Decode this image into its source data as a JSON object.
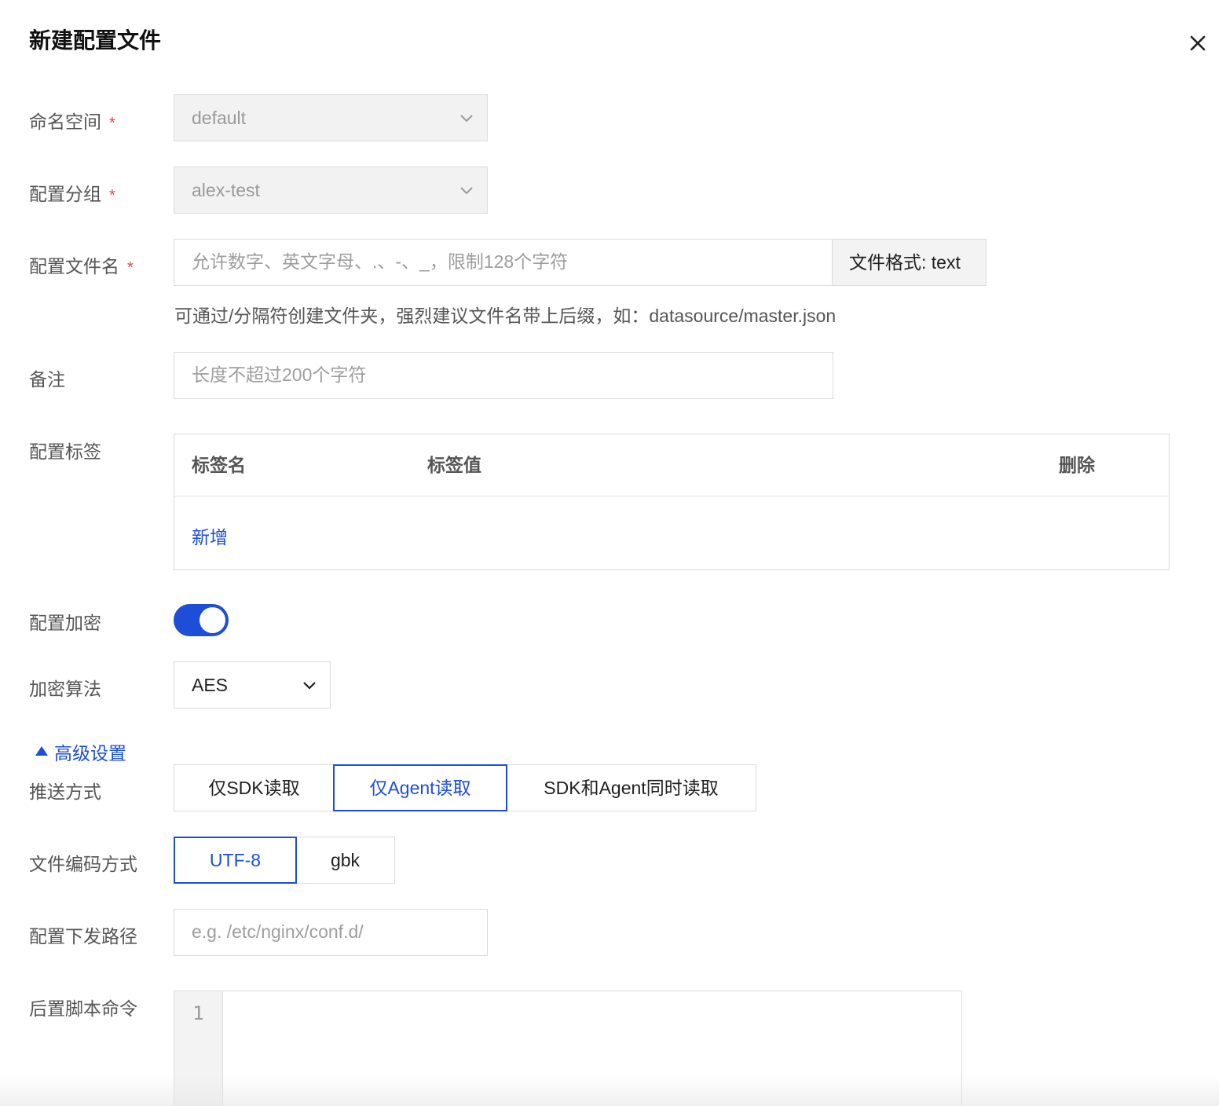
{
  "dialog": {
    "title": "新建配置文件",
    "close_icon": "close-icon"
  },
  "namespace": {
    "label": "命名空间",
    "required": "*",
    "value": "default"
  },
  "group": {
    "label": "配置分组",
    "required": "*",
    "value": "alex-test"
  },
  "filename": {
    "label": "配置文件名",
    "required": "*",
    "placeholder": "允许数字、英文字母、.、-、_，限制128个字符",
    "format_addon": "文件格式: text",
    "hint": "可通过/分隔符创建文件夹，强烈建议文件名带上后缀，如：datasource/master.json"
  },
  "remark": {
    "label": "备注",
    "placeholder": "长度不超过200个字符"
  },
  "tags": {
    "label": "配置标签",
    "col_name": "标签名",
    "col_value": "标签值",
    "col_delete": "删除",
    "add_link": "新增"
  },
  "encryption": {
    "label": "配置加密",
    "enabled": true
  },
  "algorithm": {
    "label": "加密算法",
    "value": "AES"
  },
  "advanced": {
    "toggle_label": "高级设置",
    "expanded": true
  },
  "push_mode": {
    "label": "推送方式",
    "options": [
      "仅SDK读取",
      "仅Agent读取",
      "SDK和Agent同时读取"
    ],
    "selected": "仅Agent读取"
  },
  "encoding": {
    "label": "文件编码方式",
    "options": [
      "UTF-8",
      "gbk"
    ],
    "selected": "UTF-8"
  },
  "deploy_path": {
    "label": "配置下发路径",
    "placeholder": "e.g. /etc/nginx/conf.d/"
  },
  "post_script": {
    "label": "后置脚本命令",
    "line_number": "1"
  },
  "colors": {
    "accent": "#1d4fd6",
    "required": "#e54545"
  }
}
